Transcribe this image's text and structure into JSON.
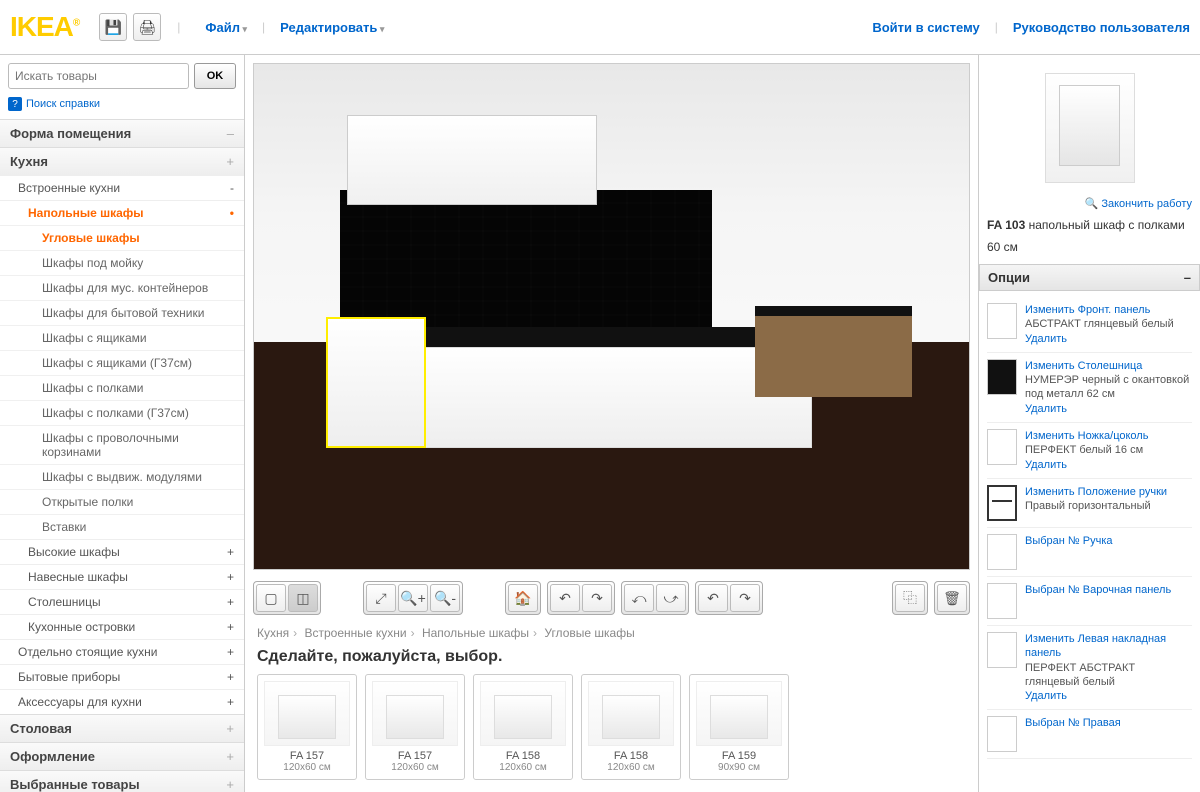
{
  "header": {
    "logo": "IKEA",
    "menu_file": "Файл",
    "menu_edit": "Редактировать",
    "login": "Войти в систему",
    "guide": "Руководство пользователя"
  },
  "search": {
    "placeholder": "Искать товары",
    "ok": "OK",
    "help": "Поиск справки"
  },
  "sidebar": {
    "cats": [
      {
        "label": "Форма помещения",
        "exp": "–"
      },
      {
        "label": "Кухня",
        "exp": "+"
      }
    ],
    "subcats_top": [
      {
        "label": "Встроенные кухни",
        "active": false,
        "exp": "-"
      }
    ],
    "active_group": "Напольные шкафы",
    "items": [
      {
        "label": "Угловые шкафы",
        "active": true
      },
      {
        "label": "Шкафы под мойку"
      },
      {
        "label": "Шкафы для мус. контейнеров"
      },
      {
        "label": "Шкафы для бытовой техники"
      },
      {
        "label": "Шкафы с ящиками"
      },
      {
        "label": "Шкафы с ящиками (Г37см)"
      },
      {
        "label": "Шкафы с полками"
      },
      {
        "label": "Шкафы с полками (Г37см)"
      },
      {
        "label": "Шкафы с проволочными корзинами"
      },
      {
        "label": "Шкафы с выдвиж. модулями"
      },
      {
        "label": "Открытые полки"
      },
      {
        "label": "Вставки"
      }
    ],
    "siblings": [
      "Высокие шкафы",
      "Навесные шкафы",
      "Столешницы",
      "Кухонные островки"
    ],
    "subcats_bottom": [
      "Отдельно стоящие кухни",
      "Бытовые приборы",
      "Аксессуары для кухни"
    ],
    "cats_bottom": [
      "Столовая",
      "Оформление",
      "Выбранные товары"
    ]
  },
  "breadcrumb": [
    "Кухня",
    "Встроенные кухни",
    "Напольные шкафы",
    "Угловые шкафы"
  ],
  "prompt": "Сделайте, пожалуйста, выбор.",
  "products": [
    {
      "name": "FA 157",
      "dim": "120x60 см"
    },
    {
      "name": "FA 157",
      "dim": "120x60 см"
    },
    {
      "name": "FA 158",
      "dim": "120x60 см"
    },
    {
      "name": "FA 158",
      "dim": "120x60 см"
    },
    {
      "name": "FA 159",
      "dim": "90x90 см"
    }
  ],
  "right": {
    "finish": "Закончить работу",
    "code": "FA 103",
    "desc": "напольный шкаф с полками",
    "size": "60 см",
    "options_hdr": "Опции",
    "opts": [
      {
        "link": "Изменить Фронт. панель",
        "desc": "АБСТРАКТ глянцевый белый",
        "del": "Удалить",
        "sw": ""
      },
      {
        "link": "Изменить Столешница",
        "desc": "НУМЕРЭР черный с окантовкой под металл 62 см",
        "del": "Удалить",
        "sw": "black"
      },
      {
        "link": "Изменить Ножка/цоколь",
        "desc": "ПЕРФЕКТ белый 16 см",
        "del": "Удалить",
        "sw": ""
      },
      {
        "link": "Изменить Положение ручки",
        "desc": "Правый горизонтальный",
        "del": "",
        "sw": "outline"
      },
      {
        "link": "Выбран № Ручка",
        "desc": "",
        "del": "",
        "sw": ""
      },
      {
        "link": "Выбран № Варочная панель",
        "desc": "",
        "del": "",
        "sw": ""
      },
      {
        "link": "Изменить Левая накладная панель",
        "desc": "ПЕРФЕКТ АБСТРАКТ глянцевый белый",
        "del": "Удалить",
        "sw": ""
      },
      {
        "link": "Выбран № Правая",
        "desc": "",
        "del": "",
        "sw": ""
      }
    ]
  }
}
